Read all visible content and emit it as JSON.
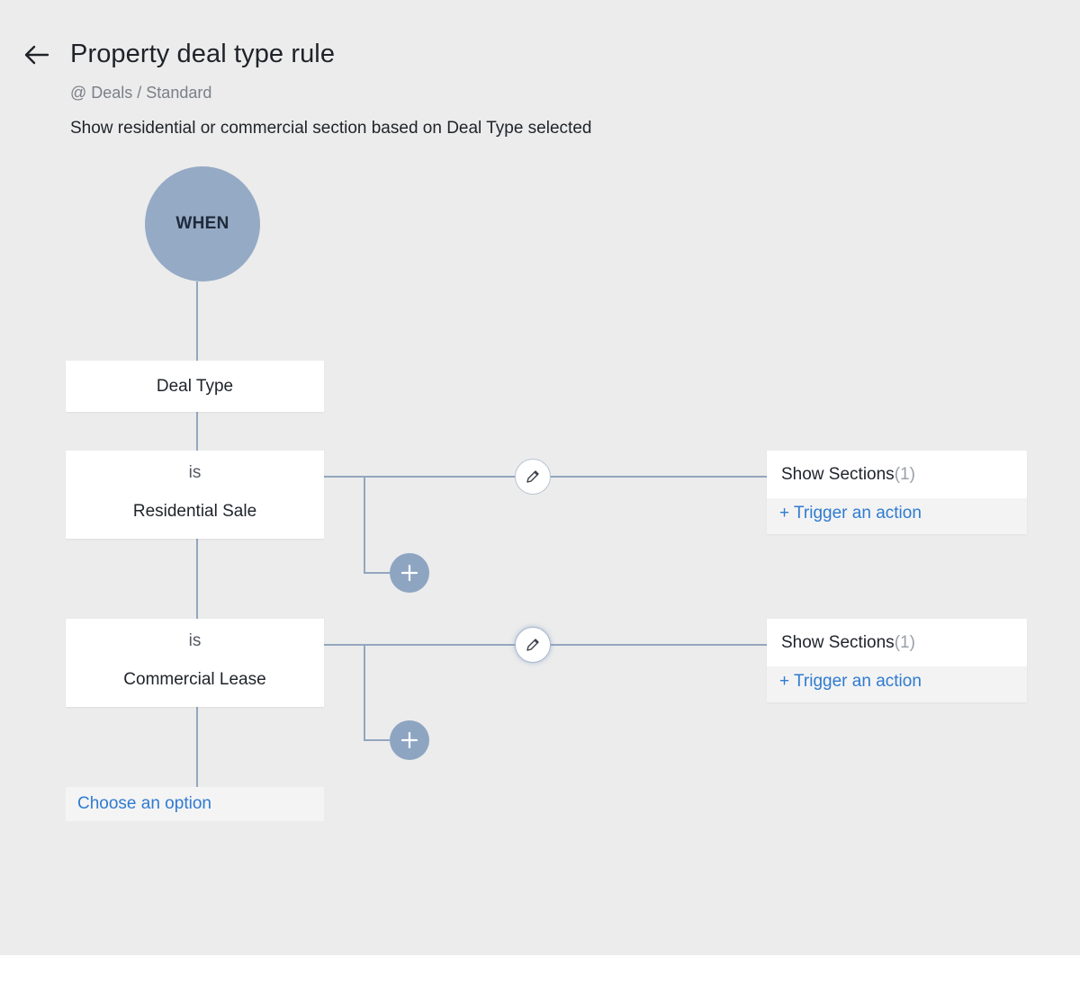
{
  "header": {
    "title": "Property deal type rule",
    "breadcrumb": "@ Deals / Standard",
    "description": "Show residential or commercial section based on Deal Type selected"
  },
  "flow": {
    "when_label": "WHEN",
    "field_label": "Deal Type",
    "conditions": [
      {
        "operator": "is",
        "value": "Residential Sale",
        "action": {
          "label": "Show Sections",
          "count": "(1)",
          "trigger_label": "+ Trigger an action"
        }
      },
      {
        "operator": "is",
        "value": "Commercial Lease",
        "action": {
          "label": "Show Sections",
          "count": "(1)",
          "trigger_label": "+ Trigger an action"
        }
      }
    ],
    "choose_option": "Choose an option"
  },
  "colors": {
    "canvas_background": "#ececec",
    "when_node": "#95aac5",
    "connector": "#93a6be",
    "add_button": "#8ea5c2",
    "link": "#2f7bd0"
  },
  "icons": {
    "back": "arrow-left-icon",
    "edit": "pencil-icon",
    "add": "plus-icon"
  }
}
